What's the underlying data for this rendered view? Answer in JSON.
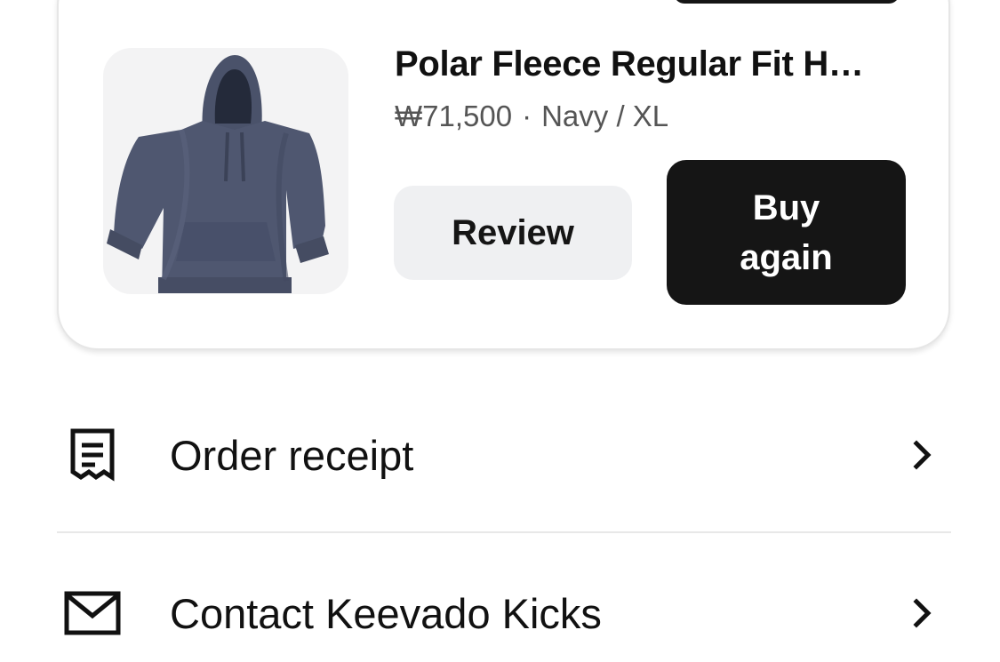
{
  "product": {
    "title": "Polar Fleece Regular Fit H…",
    "price": "₩71,500",
    "separator": "·",
    "variant": "Navy / XL",
    "image_icon": "hoodie-product-image",
    "review_label": "Review",
    "buy_again_label": "Buy\nagain"
  },
  "menu": {
    "items": [
      {
        "label": "Order receipt",
        "icon": "receipt-icon"
      },
      {
        "label": "Contact Keevado Kicks",
        "icon": "mail-icon"
      }
    ]
  },
  "colors": {
    "primary_button": "#151515",
    "secondary_button": "#eff0f2",
    "hoodie": "#4f5770"
  }
}
